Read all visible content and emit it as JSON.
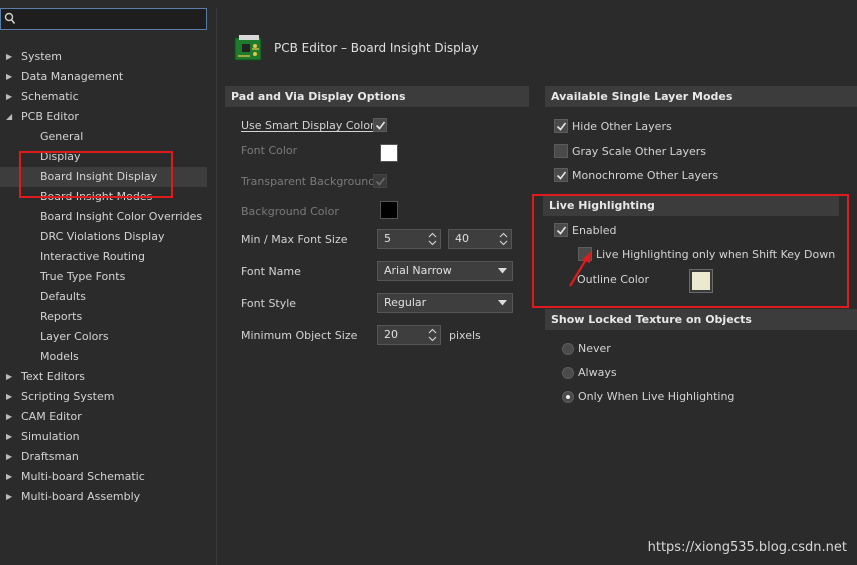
{
  "search": {
    "value": "",
    "placeholder": ""
  },
  "tree": [
    {
      "label": "System",
      "expanded": false,
      "level": 0
    },
    {
      "label": "Data Management",
      "expanded": false,
      "level": 0
    },
    {
      "label": "Schematic",
      "expanded": false,
      "level": 0
    },
    {
      "label": "PCB Editor",
      "expanded": true,
      "level": 0
    },
    {
      "label": "General",
      "level": 1
    },
    {
      "label": "Display",
      "level": 1
    },
    {
      "label": "Board Insight Display",
      "level": 1,
      "selected": true
    },
    {
      "label": "Board Insight Modes",
      "level": 1
    },
    {
      "label": "Board Insight Color Overrides",
      "level": 1
    },
    {
      "label": "DRC Violations Display",
      "level": 1
    },
    {
      "label": "Interactive Routing",
      "level": 1
    },
    {
      "label": "True Type Fonts",
      "level": 1
    },
    {
      "label": "Defaults",
      "level": 1
    },
    {
      "label": "Reports",
      "level": 1
    },
    {
      "label": "Layer Colors",
      "level": 1
    },
    {
      "label": "Models",
      "level": 1
    },
    {
      "label": "Text Editors",
      "expanded": false,
      "level": 0
    },
    {
      "label": "Scripting System",
      "expanded": false,
      "level": 0
    },
    {
      "label": "CAM Editor",
      "expanded": false,
      "level": 0
    },
    {
      "label": "Simulation",
      "expanded": false,
      "level": 0
    },
    {
      "label": "Draftsman",
      "expanded": false,
      "level": 0
    },
    {
      "label": "Multi-board Schematic",
      "expanded": false,
      "level": 0
    },
    {
      "label": "Multi-board Assembly",
      "expanded": false,
      "level": 0
    }
  ],
  "page": {
    "title": "PCB Editor – Board Insight Display"
  },
  "pad_via": {
    "heading": "Pad and Via Display Options",
    "use_smart": {
      "label": "Use Smart Display Color",
      "checked": true
    },
    "font_color": {
      "label": "Font Color",
      "color": "#ffffff"
    },
    "transparent_bg": {
      "label": "Transparent Background",
      "checked": true
    },
    "bg_color": {
      "label": "Background Color",
      "color": "#000000"
    },
    "font_size": {
      "label": "Min / Max Font Size",
      "min": "5",
      "max": "40"
    },
    "font_name": {
      "label": "Font Name",
      "value": "Arial Narrow"
    },
    "font_style": {
      "label": "Font Style",
      "value": "Regular"
    },
    "min_obj": {
      "label": "Minimum Object Size",
      "value": "20",
      "unit": "pixels"
    }
  },
  "single_layer": {
    "heading": "Available Single Layer Modes",
    "hide_other": {
      "label": "Hide Other Layers",
      "checked": true
    },
    "gray_scale": {
      "label": "Gray Scale Other Layers",
      "checked": false
    },
    "monochrome": {
      "label": "Monochrome Other Layers",
      "checked": true
    }
  },
  "live": {
    "heading": "Live Highlighting",
    "enabled": {
      "label": "Enabled",
      "checked": true
    },
    "shift_only": {
      "label": "Live Highlighting only when Shift Key Down",
      "checked": false
    },
    "outline": {
      "label": "Outline Color",
      "color": "#ece9d0"
    }
  },
  "locked": {
    "heading": "Show Locked Texture on Objects",
    "options": [
      {
        "label": "Never",
        "selected": false
      },
      {
        "label": "Always",
        "selected": false
      },
      {
        "label": "Only When Live Highlighting",
        "selected": true
      }
    ]
  },
  "watermark": "https://xiong535.blog.csdn.net",
  "colors": {
    "highlight_box": "#e01b1b",
    "panel_bg": "#2b2b2b",
    "header_bg": "#3c3c3c"
  }
}
